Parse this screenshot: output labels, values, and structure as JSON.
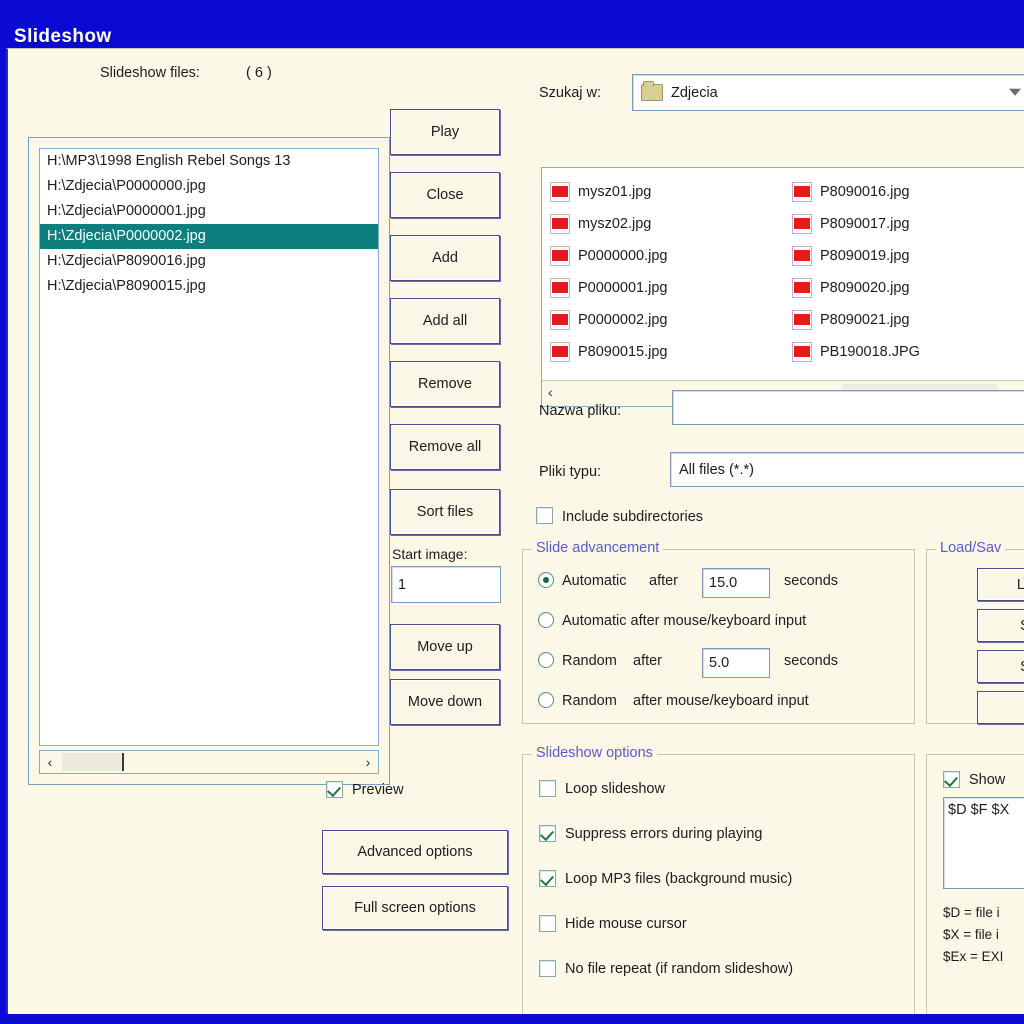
{
  "window": {
    "title": "Slideshow"
  },
  "left_panel": {
    "files_label": "Slideshow files:",
    "files_count": "( 6 )",
    "items": [
      "H:\\MP3\\1998 English Rebel Songs 13",
      "H:\\Zdjecia\\P0000000.jpg",
      "H:\\Zdjecia\\P0000001.jpg",
      "H:\\Zdjecia\\P0000002.jpg",
      "H:\\Zdjecia\\P8090016.jpg",
      "H:\\Zdjecia\\P8090015.jpg"
    ],
    "selected_index": 3,
    "scroll_left_arrow": "‹",
    "scroll_right_arrow": "›"
  },
  "buttons": {
    "play": "Play",
    "close": "Close",
    "add": "Add",
    "add_all": "Add all",
    "remove": "Remove",
    "remove_all": "Remove all",
    "sort_files": "Sort files",
    "move_up": "Move up",
    "move_down": "Move down",
    "advanced_options": "Advanced options",
    "full_screen_options": "Full screen options"
  },
  "start_image": {
    "label": "Start image:",
    "value": "1"
  },
  "preview": {
    "label": "Preview",
    "checked": true
  },
  "browser": {
    "look_in_label": "Szukaj w:",
    "look_in_value": "Zdjecia",
    "files_col1": [
      "mysz01.jpg",
      "mysz02.jpg",
      "P0000000.jpg",
      "P0000001.jpg",
      "P0000002.jpg",
      "P8090015.jpg"
    ],
    "files_col2": [
      "P8090016.jpg",
      "P8090017.jpg",
      "P8090019.jpg",
      "P8090020.jpg",
      "P8090021.jpg",
      "PB190018.JPG"
    ],
    "file_name_label": "Nazwa pliku:",
    "file_name_value": "",
    "file_type_label": "Pliki typu:",
    "file_type_value": "All files (*.*)",
    "include_subdirs_label": "Include subdirectories",
    "include_subdirs_checked": false,
    "scroll_left_arrow": "‹"
  },
  "slide_advancement": {
    "title": "Slide advancement",
    "options": [
      {
        "label_a": "Automatic",
        "label_mid": "after",
        "value": "15.0",
        "label_b": "seconds",
        "selected": true
      },
      {
        "label_a": "Automatic after mouse/keyboard input",
        "selected": false
      },
      {
        "label_a": "Random",
        "label_mid": "after",
        "value": "5.0",
        "label_b": "seconds",
        "selected": false
      },
      {
        "label_a": "Random",
        "label_mid": "after mouse/keyboard input",
        "selected": false
      }
    ]
  },
  "slideshow_options": {
    "title": "Slideshow options",
    "items": [
      {
        "label": "Loop slideshow",
        "checked": false
      },
      {
        "label": "Suppress errors during playing",
        "checked": true
      },
      {
        "label": "Loop MP3 files (background music)",
        "checked": true
      },
      {
        "label": "Hide mouse cursor",
        "checked": false
      },
      {
        "label": "No file repeat (if random slideshow)",
        "checked": false
      }
    ]
  },
  "load_save": {
    "title": "Load/Sav",
    "buttons": [
      "Lo",
      "S",
      "S",
      ""
    ]
  },
  "show_text": {
    "checkbox_label": "Show",
    "checked": true,
    "value": "$D $F  $X",
    "legend": [
      "$D = file i",
      "$X = file i",
      "$Ex = EXI"
    ]
  }
}
